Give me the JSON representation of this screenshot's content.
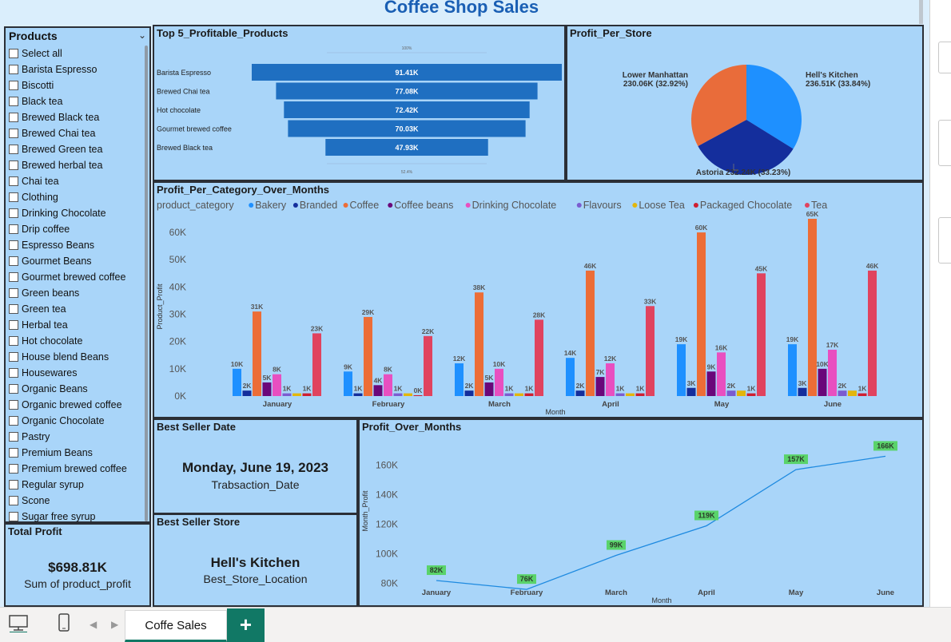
{
  "report_title": "Coffee Shop Sales",
  "slicer": {
    "title": "Products",
    "items": [
      "Select all",
      "Barista Espresso",
      "Biscotti",
      "Black tea",
      "Brewed Black tea",
      "Brewed Chai tea",
      "Brewed Green tea",
      "Brewed herbal tea",
      "Chai tea",
      "Clothing",
      "Drinking Chocolate",
      "Drip coffee",
      "Espresso Beans",
      "Gourmet Beans",
      "Gourmet brewed coffee",
      "Green beans",
      "Green tea",
      "Herbal tea",
      "Hot chocolate",
      "House blend Beans",
      "Housewares",
      "Organic Beans",
      "Organic brewed coffee",
      "Organic Chocolate",
      "Pastry",
      "Premium Beans",
      "Premium brewed coffee",
      "Regular syrup",
      "Scone",
      "Sugar free syrup"
    ]
  },
  "total_profit": {
    "title": "Total Profit",
    "value": "$698.81K",
    "label": "Sum of product_profit"
  },
  "best_date": {
    "title": "Best Seller Date",
    "value": "Monday, June 19, 2023",
    "label": "Trabsaction_Date"
  },
  "best_store": {
    "title": "Best Seller Store",
    "value": "Hell's Kitchen",
    "label": "Best_Store_Location"
  },
  "colors": {
    "funnel": "#1f6fc1",
    "pie": [
      "#1e90ff",
      "#142e9c",
      "#e96c3a"
    ],
    "series": [
      "#1e90ff",
      "#142e9c",
      "#ec6d37",
      "#6a077a",
      "#e84fc0",
      "#7b5cd0",
      "#e3b60c",
      "#cf1f31",
      "#e0435f"
    ],
    "line": "#1e8ae0",
    "line_label_bg": "#5ad36a"
  },
  "bottom": {
    "tab": "Coffe Sales",
    "add": "+"
  },
  "chart_data": [
    {
      "id": "top5",
      "type": "bar",
      "title": "Top 5_Profitable_Products",
      "categories": [
        "Barista Espresso",
        "Brewed Chai tea",
        "Hot chocolate",
        "Gourmet brewed coffee",
        "Brewed Black tea"
      ],
      "values": [
        91.41,
        77.08,
        72.42,
        70.03,
        47.93
      ],
      "value_labels": [
        "91.41K",
        "77.08K",
        "72.42K",
        "70.03K",
        "47.93K"
      ],
      "top_pct": "100%",
      "bottom_pct": "52.4%"
    },
    {
      "id": "store_pie",
      "type": "pie",
      "title": "Profit_Per_Store",
      "slices": [
        {
          "name": "Hell's Kitchen",
          "value": 236.51,
          "label": "236.51K (33.84%)"
        },
        {
          "name": "Astoria",
          "value": 232.24,
          "label": "232.24K (33.23%)"
        },
        {
          "name": "Lower Manhattan",
          "value": 230.06,
          "label": "230.06K (32.92%)"
        }
      ]
    },
    {
      "id": "category_months",
      "type": "bar",
      "title": "Profit_Per_Category_Over_Months",
      "legend_title": "product_category",
      "xlabel": "Month",
      "ylabel": "Product_Profit",
      "ylim": [
        0,
        65
      ],
      "yticks": [
        "0K",
        "10K",
        "20K",
        "30K",
        "40K",
        "50K",
        "60K"
      ],
      "categories": [
        "January",
        "February",
        "March",
        "April",
        "May",
        "June"
      ],
      "series": [
        {
          "name": "Bakery",
          "values": [
            10,
            9,
            12,
            14,
            19,
            19
          ],
          "labels": [
            "10K",
            "9K",
            "12K",
            "14K",
            "19K",
            "19K"
          ]
        },
        {
          "name": "Branded",
          "values": [
            2,
            1,
            2,
            2,
            3,
            3
          ],
          "labels": [
            "2K",
            "1K",
            "2K",
            "2K",
            "3K",
            "3K"
          ]
        },
        {
          "name": "Coffee",
          "values": [
            31,
            29,
            38,
            46,
            60,
            65
          ],
          "labels": [
            "31K",
            "29K",
            "38K",
            "46K",
            "60K",
            "65K"
          ]
        },
        {
          "name": "Coffee beans",
          "values": [
            5,
            4,
            5,
            7,
            9,
            10
          ],
          "labels": [
            "5K",
            "4K",
            "5K",
            "7K",
            "9K",
            "10K"
          ]
        },
        {
          "name": "Drinking Chocolate",
          "values": [
            8,
            8,
            10,
            12,
            16,
            17
          ],
          "labels": [
            "8K",
            "8K",
            "10K",
            "12K",
            "16K",
            "17K"
          ]
        },
        {
          "name": "Flavours",
          "values": [
            1,
            1,
            1,
            1,
            2,
            2
          ],
          "labels": [
            "1K",
            "1K",
            "1K",
            "1K",
            "2K",
            "2K"
          ]
        },
        {
          "name": "Loose Tea",
          "values": [
            1,
            1,
            1,
            1,
            2,
            2
          ],
          "labels": [
            "",
            "",
            "",
            "",
            "",
            ""
          ]
        },
        {
          "name": "Packaged Chocolate",
          "values": [
            1,
            0.3,
            1,
            1,
            1,
            1
          ],
          "labels": [
            "1K",
            "0K",
            "1K",
            "1K",
            "1K",
            "1K"
          ]
        },
        {
          "name": "Tea",
          "values": [
            23,
            22,
            28,
            33,
            45,
            46
          ],
          "labels": [
            "23K",
            "22K",
            "28K",
            "33K",
            "45K",
            "46K"
          ]
        }
      ]
    },
    {
      "id": "profit_months",
      "type": "line",
      "title": "Profit_Over_Months",
      "xlabel": "Month",
      "ylabel": "Month_Profit",
      "ylim": [
        75,
        170
      ],
      "yticks": [
        "80K",
        "100K",
        "120K",
        "140K",
        "160K"
      ],
      "categories": [
        "January",
        "February",
        "March",
        "April",
        "May",
        "June"
      ],
      "values": [
        82,
        76,
        99,
        119,
        157,
        166
      ],
      "value_labels": [
        "82K",
        "76K",
        "99K",
        "119K",
        "157K",
        "166K"
      ]
    }
  ]
}
